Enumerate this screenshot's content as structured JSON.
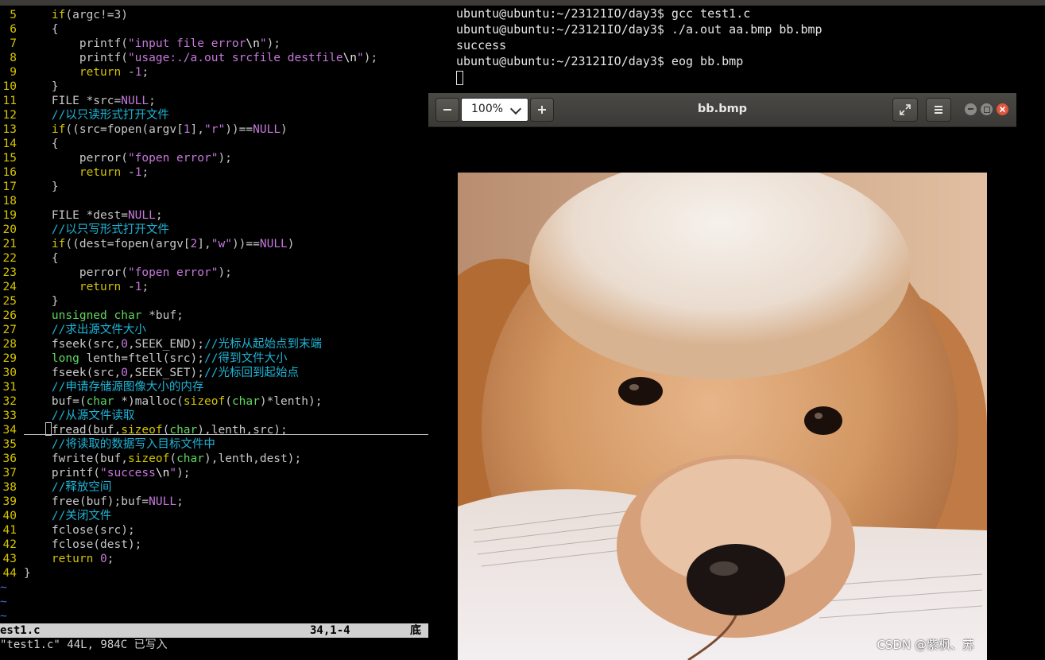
{
  "editor": {
    "lines": [
      {
        "n": "5",
        "segs": [
          [
            "    ",
            "p"
          ],
          [
            "if",
            "kw"
          ],
          [
            "(argc!=3)",
            "p"
          ]
        ]
      },
      {
        "n": "6",
        "segs": [
          [
            "    {",
            "p"
          ]
        ]
      },
      {
        "n": "7",
        "segs": [
          [
            "        printf(",
            "p"
          ],
          [
            "\"input file error",
            "st"
          ],
          [
            "\\n",
            "es"
          ],
          [
            "\"",
            "st"
          ],
          [
            ");",
            "p"
          ]
        ]
      },
      {
        "n": "8",
        "segs": [
          [
            "        printf(",
            "p"
          ],
          [
            "\"usage:./a.out srcfile destfile",
            "st"
          ],
          [
            "\\n",
            "es"
          ],
          [
            "\"",
            "st"
          ],
          [
            ");",
            "p"
          ]
        ]
      },
      {
        "n": "9",
        "segs": [
          [
            "        ",
            "p"
          ],
          [
            "return",
            "kw"
          ],
          [
            " -",
            "p"
          ],
          [
            "1",
            "nu"
          ],
          [
            ";",
            "p"
          ]
        ]
      },
      {
        "n": "10",
        "segs": [
          [
            "    }",
            "p"
          ]
        ]
      },
      {
        "n": "11",
        "segs": [
          [
            "    FILE *src=",
            "p"
          ],
          [
            "NULL",
            "nu"
          ],
          [
            ";",
            "p"
          ]
        ]
      },
      {
        "n": "12",
        "segs": [
          [
            "    //以只读形式打开文件",
            "cm"
          ]
        ]
      },
      {
        "n": "13",
        "segs": [
          [
            "    ",
            "p"
          ],
          [
            "if",
            "kw"
          ],
          [
            "((src=fopen(argv[",
            "p"
          ],
          [
            "1",
            "nu"
          ],
          [
            "],",
            "p"
          ],
          [
            "\"r\"",
            "st"
          ],
          [
            "))==",
            "p"
          ],
          [
            "NULL",
            "nu"
          ],
          [
            ")",
            "p"
          ]
        ]
      },
      {
        "n": "14",
        "segs": [
          [
            "    {",
            "p"
          ]
        ]
      },
      {
        "n": "15",
        "segs": [
          [
            "        perror(",
            "p"
          ],
          [
            "\"fopen error\"",
            "st"
          ],
          [
            ");",
            "p"
          ]
        ]
      },
      {
        "n": "16",
        "segs": [
          [
            "        ",
            "p"
          ],
          [
            "return",
            "kw"
          ],
          [
            " -",
            "p"
          ],
          [
            "1",
            "nu"
          ],
          [
            ";",
            "p"
          ]
        ]
      },
      {
        "n": "17",
        "segs": [
          [
            "    }",
            "p"
          ]
        ]
      },
      {
        "n": "18",
        "segs": []
      },
      {
        "n": "19",
        "segs": [
          [
            "    FILE *dest=",
            "p"
          ],
          [
            "NULL",
            "nu"
          ],
          [
            ";",
            "p"
          ]
        ]
      },
      {
        "n": "20",
        "segs": [
          [
            "    //以只写形式打开文件",
            "cm"
          ]
        ]
      },
      {
        "n": "21",
        "segs": [
          [
            "    ",
            "p"
          ],
          [
            "if",
            "kw"
          ],
          [
            "((dest=fopen(argv[",
            "p"
          ],
          [
            "2",
            "nu"
          ],
          [
            "],",
            "p"
          ],
          [
            "\"w\"",
            "st"
          ],
          [
            "))==",
            "p"
          ],
          [
            "NULL",
            "nu"
          ],
          [
            ")",
            "p"
          ]
        ]
      },
      {
        "n": "22",
        "segs": [
          [
            "    {",
            "p"
          ]
        ]
      },
      {
        "n": "23",
        "segs": [
          [
            "        perror(",
            "p"
          ],
          [
            "\"fopen error\"",
            "st"
          ],
          [
            ");",
            "p"
          ]
        ]
      },
      {
        "n": "24",
        "segs": [
          [
            "        ",
            "p"
          ],
          [
            "return",
            "kw"
          ],
          [
            " -",
            "p"
          ],
          [
            "1",
            "nu"
          ],
          [
            ";",
            "p"
          ]
        ]
      },
      {
        "n": "25",
        "segs": [
          [
            "    }",
            "p"
          ]
        ]
      },
      {
        "n": "26",
        "segs": [
          [
            "    ",
            "p"
          ],
          [
            "unsigned char",
            "ty"
          ],
          [
            " *buf;",
            "p"
          ]
        ]
      },
      {
        "n": "27",
        "segs": [
          [
            "    //求出源文件大小",
            "cm"
          ]
        ]
      },
      {
        "n": "28",
        "segs": [
          [
            "    fseek(src,",
            "p"
          ],
          [
            "0",
            "nu"
          ],
          [
            ",SEEK_END);",
            "p"
          ],
          [
            "//光标从起始点到末端",
            "cm"
          ]
        ]
      },
      {
        "n": "29",
        "segs": [
          [
            "    ",
            "p"
          ],
          [
            "long",
            "ty"
          ],
          [
            " lenth=ftell(src);",
            "p"
          ],
          [
            "//得到文件大小",
            "cm"
          ]
        ]
      },
      {
        "n": "30",
        "segs": [
          [
            "    fseek(src,",
            "p"
          ],
          [
            "0",
            "nu"
          ],
          [
            ",SEEK_SET);",
            "p"
          ],
          [
            "//光标回到起始点",
            "cm"
          ]
        ]
      },
      {
        "n": "31",
        "segs": [
          [
            "    //申请存储源图像大小的内存",
            "cm"
          ]
        ]
      },
      {
        "n": "32",
        "segs": [
          [
            "    buf=(",
            "p"
          ],
          [
            "char",
            "ty"
          ],
          [
            " *)malloc(",
            "p"
          ],
          [
            "sizeof",
            "kw"
          ],
          [
            "(",
            "p"
          ],
          [
            "char",
            "ty"
          ],
          [
            ")*lenth);",
            "p"
          ]
        ]
      },
      {
        "n": "33",
        "segs": [
          [
            "    //从源文件读取",
            "cm"
          ]
        ]
      },
      {
        "n": "34",
        "segs": [
          [
            "    fread(buf,",
            "p"
          ],
          [
            "sizeof",
            "kw"
          ],
          [
            "(",
            "p"
          ],
          [
            "char",
            "ty"
          ],
          [
            "),lenth,src);",
            "p"
          ]
        ]
      },
      {
        "n": "35",
        "segs": [
          [
            "    //将读取的数据写入目标文件中",
            "cm"
          ]
        ]
      },
      {
        "n": "36",
        "segs": [
          [
            "    fwrite(buf,",
            "p"
          ],
          [
            "sizeof",
            "kw"
          ],
          [
            "(",
            "p"
          ],
          [
            "char",
            "ty"
          ],
          [
            "),lenth,dest);",
            "p"
          ]
        ]
      },
      {
        "n": "37",
        "segs": [
          [
            "    printf(",
            "p"
          ],
          [
            "\"success",
            "st"
          ],
          [
            "\\n",
            "es"
          ],
          [
            "\"",
            "st"
          ],
          [
            ");",
            "p"
          ]
        ]
      },
      {
        "n": "38",
        "segs": [
          [
            "    //释放空间",
            "cm"
          ]
        ]
      },
      {
        "n": "39",
        "segs": [
          [
            "    free(buf);buf=",
            "p"
          ],
          [
            "NULL",
            "nu"
          ],
          [
            ";",
            "p"
          ]
        ]
      },
      {
        "n": "40",
        "segs": [
          [
            "    //关闭文件",
            "cm"
          ]
        ]
      },
      {
        "n": "41",
        "segs": [
          [
            "    fclose(src);",
            "p"
          ]
        ]
      },
      {
        "n": "42",
        "segs": [
          [
            "    fclose(dest);",
            "p"
          ]
        ]
      },
      {
        "n": "43",
        "segs": [
          [
            "    ",
            "p"
          ],
          [
            "return",
            "kw"
          ],
          [
            " ",
            "p"
          ],
          [
            "0",
            "nu"
          ],
          [
            ";",
            "p"
          ]
        ]
      },
      {
        "n": "44",
        "segs": [
          [
            "}",
            "p"
          ]
        ]
      }
    ],
    "tilde_lines": [
      "~",
      "~",
      "~"
    ],
    "status_file": "est1.c",
    "status_pos": "34,1-4",
    "status_right": "底",
    "cmd_message": "\"test1.c\" 44L, 984C 已写入"
  },
  "terminal": {
    "lines": [
      "ubuntu@ubuntu:~/23121IO/day3$ gcc test1.c",
      "ubuntu@ubuntu:~/23121IO/day3$ ./a.out aa.bmp bb.bmp",
      "success",
      "ubuntu@ubuntu:~/23121IO/day3$ eog bb.bmp"
    ]
  },
  "image_viewer": {
    "title": "bb.bmp",
    "zoom": "100%",
    "zoom_out_icon": "minus-icon",
    "zoom_in_icon": "plus-icon",
    "fullscreen_icon": "expand-icon",
    "menu_icon": "hamburger-menu-icon",
    "window_buttons": {
      "minimize": "#8a8a85",
      "maximize": "#8a8a85",
      "close": "#e1553d"
    },
    "image_subject": "golden retriever puppy resting its head on an open book",
    "watermark": "CSDN @紫枫、苏"
  }
}
